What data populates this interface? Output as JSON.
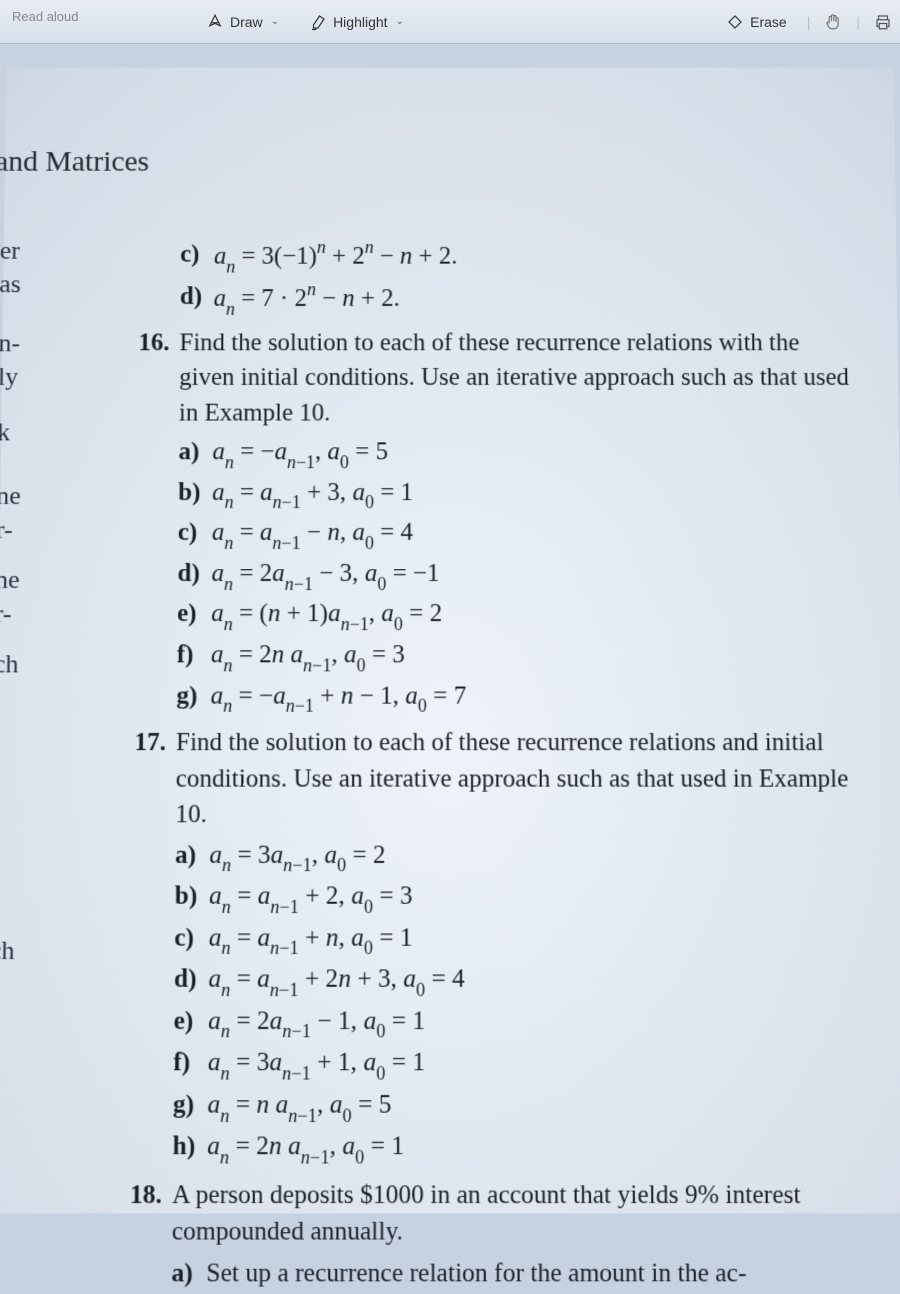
{
  "toolbar": {
    "read_aloud": "Read aloud",
    "draw": "Draw",
    "highlight": "Highlight",
    "erase": "Erase"
  },
  "page_heading_fragment": "and Matrices",
  "left_text_fragments": [
    "er",
    "as",
    "",
    "n-",
    "ly",
    "",
    "k",
    "",
    "ne",
    "r-",
    "",
    "ne",
    "r-",
    "",
    "ch",
    "",
    "",
    "",
    "",
    "",
    "",
    "",
    "",
    "ch"
  ],
  "q15_tail": {
    "c": "aₙ = 3(−1)ⁿ + 2ⁿ − n + 2.",
    "d": "aₙ = 7 · 2ⁿ − n + 2."
  },
  "q16": {
    "num": "16.",
    "prompt": "Find the solution to each of these recurrence relations with the given initial conditions. Use an iterative approach such as that used in Example 10.",
    "items": {
      "a": "aₙ = −aₙ₋₁, a₀ = 5",
      "b": "aₙ = aₙ₋₁ + 3, a₀ = 1",
      "c": "aₙ = aₙ₋₁ − n, a₀ = 4",
      "d": "aₙ = 2aₙ₋₁ − 3, a₀ = −1",
      "e": "aₙ = (n + 1)aₙ₋₁, a₀ = 2",
      "f": "aₙ = 2naₙ₋₁, a₀ = 3",
      "g": "aₙ = −aₙ₋₁ + n − 1, a₀ = 7"
    }
  },
  "q17": {
    "num": "17.",
    "prompt": "Find the solution to each of these recurrence relations and initial conditions. Use an iterative approach such as that used in Example 10.",
    "items": {
      "a": "aₙ = 3aₙ₋₁, a₀ = 2",
      "b": "aₙ = aₙ₋₁ + 2, a₀ = 3",
      "c": "aₙ = aₙ₋₁ + n, a₀ = 1",
      "d": "aₙ = aₙ₋₁ + 2n + 3, a₀ = 4",
      "e": "aₙ = 2aₙ₋₁ − 1, a₀ = 1",
      "f": "aₙ = 3aₙ₋₁ + 1, a₀ = 1",
      "g": "aₙ = naₙ₋₁, a₀ = 5",
      "h": "aₙ = 2naₙ₋₁, a₀ = 1"
    }
  },
  "q18": {
    "num": "18.",
    "prompt": "A person deposits $1000 in an account that yields 9% interest compounded annually.",
    "a": "Set up a recurrence relation for the amount in the ac-"
  },
  "labels": {
    "a": "a)",
    "b": "b)",
    "c": "c)",
    "d": "d)",
    "e": "e)",
    "f": "f)",
    "g": "g)",
    "h": "h)"
  }
}
